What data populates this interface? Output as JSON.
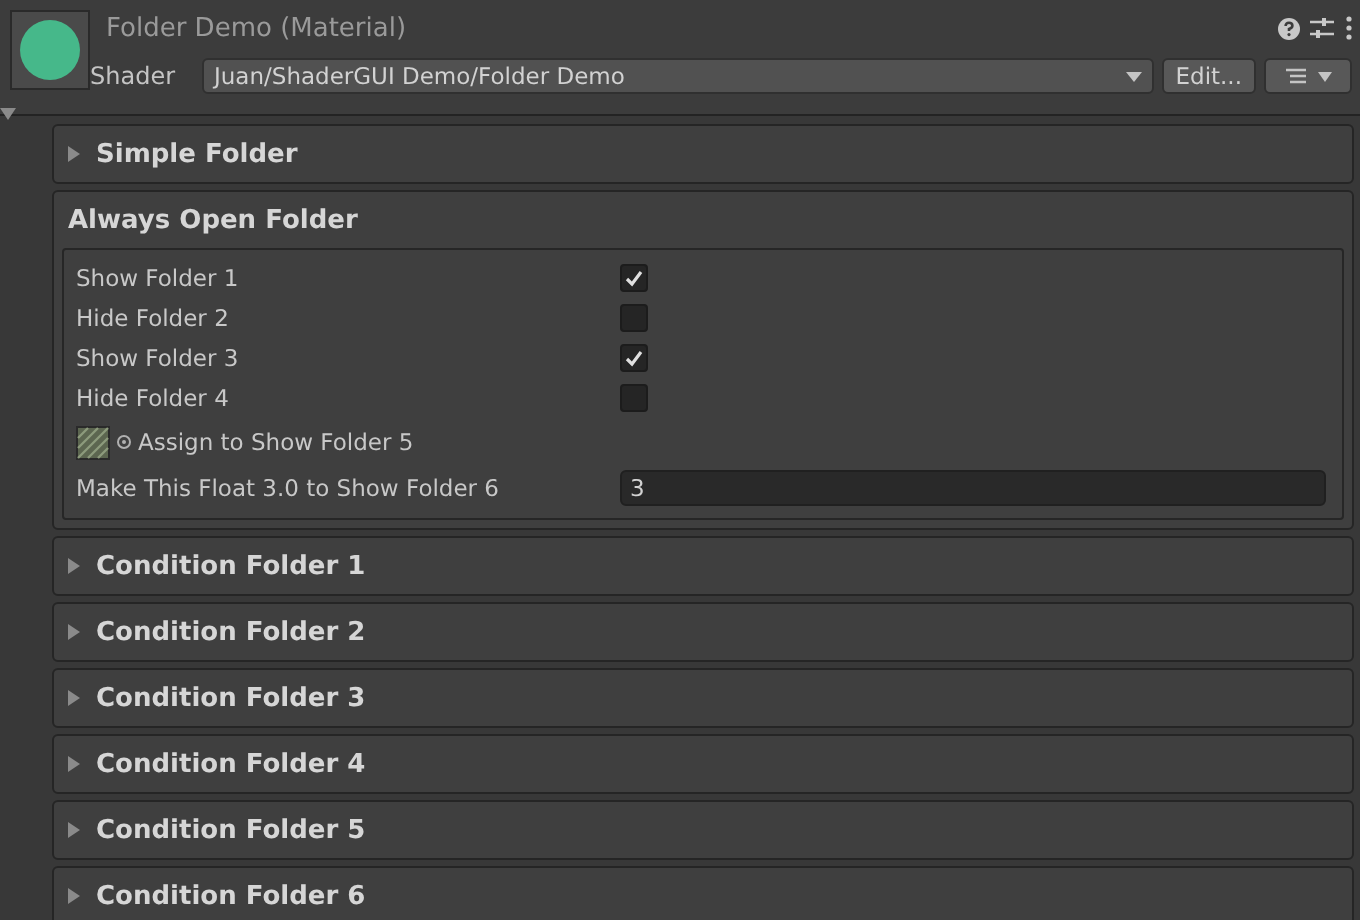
{
  "header": {
    "title": "Folder Demo (Material)",
    "shader_label": "Shader",
    "shader": "Juan/ShaderGUI Demo/Folder Demo",
    "edit_button": "Edit..."
  },
  "folders": [
    {
      "kind": "foldout",
      "title": "Simple Folder",
      "expanded": false
    },
    {
      "kind": "always_open",
      "title": "Always Open Folder",
      "properties": [
        {
          "kind": "toggle",
          "label": "Show Folder 1",
          "checked": true
        },
        {
          "kind": "toggle",
          "label": "Hide Folder 2",
          "checked": false
        },
        {
          "kind": "toggle",
          "label": "Show Folder 3",
          "checked": true
        },
        {
          "kind": "toggle",
          "label": "Hide Folder 4",
          "checked": false
        },
        {
          "kind": "texture",
          "label": "Assign to Show Folder 5"
        },
        {
          "kind": "float",
          "label": "Make This Float 3.0 to Show Folder 6",
          "value": "3"
        }
      ]
    },
    {
      "kind": "foldout",
      "title": "Condition Folder 1",
      "expanded": false
    },
    {
      "kind": "foldout",
      "title": "Condition Folder 2",
      "expanded": false
    },
    {
      "kind": "foldout",
      "title": "Condition Folder 3",
      "expanded": false
    },
    {
      "kind": "foldout",
      "title": "Condition Folder 4",
      "expanded": false
    },
    {
      "kind": "foldout",
      "title": "Condition Folder 5",
      "expanded": false
    },
    {
      "kind": "foldout",
      "title": "Condition Folder 6",
      "expanded": false
    }
  ]
}
